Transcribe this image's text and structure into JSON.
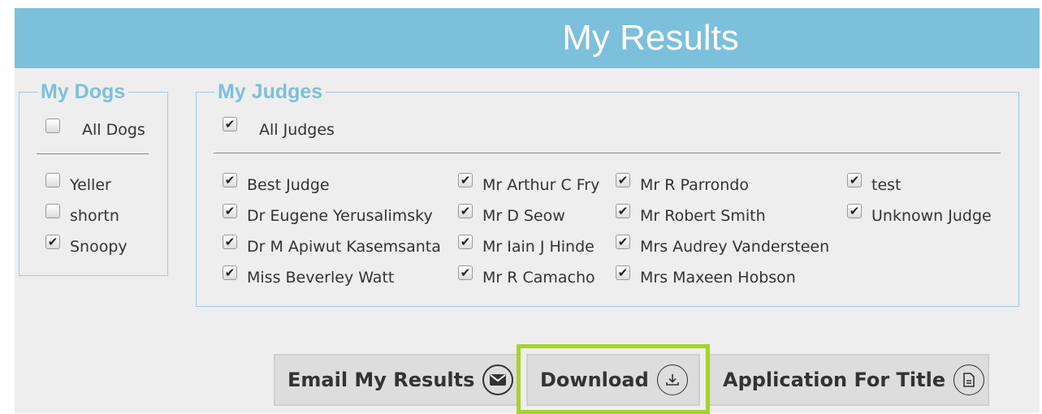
{
  "header": {
    "title": "My Results"
  },
  "dogs": {
    "legend": "My Dogs",
    "all": {
      "label": "All Dogs",
      "checked": false
    },
    "items": [
      {
        "label": "Yeller",
        "checked": false
      },
      {
        "label": "shortn",
        "checked": false
      },
      {
        "label": "Snoopy",
        "checked": true
      }
    ]
  },
  "judges": {
    "legend": "My Judges",
    "all": {
      "label": "All Judges",
      "checked": true
    },
    "items": [
      {
        "label": "Best Judge",
        "checked": true
      },
      {
        "label": "Dr Eugene Yerusalimsky",
        "checked": true
      },
      {
        "label": "Dr M Apiwut Kasemsanta",
        "checked": true
      },
      {
        "label": "Miss Beverley Watt",
        "checked": true
      },
      {
        "label": "Mr Arthur C Fry",
        "checked": true
      },
      {
        "label": "Mr D Seow",
        "checked": true
      },
      {
        "label": "Mr Iain J Hinde",
        "checked": true
      },
      {
        "label": "Mr R Camacho",
        "checked": true
      },
      {
        "label": "Mr R Parrondo",
        "checked": true
      },
      {
        "label": "Mr Robert Smith",
        "checked": true
      },
      {
        "label": "Mrs Audrey Vandersteen",
        "checked": true
      },
      {
        "label": "Mrs Maxeen Hobson",
        "checked": true
      },
      {
        "label": "test",
        "checked": true
      },
      {
        "label": "Unknown Judge",
        "checked": true
      }
    ]
  },
  "buttons": {
    "email": {
      "label": "Email My Results",
      "icon": "envelope-icon"
    },
    "download": {
      "label": "Download",
      "icon": "download-icon"
    },
    "application": {
      "label": "Application For Title",
      "icon": "document-icon"
    }
  },
  "colors": {
    "header": "#7cc0dc",
    "highlight": "#a4d42b"
  }
}
